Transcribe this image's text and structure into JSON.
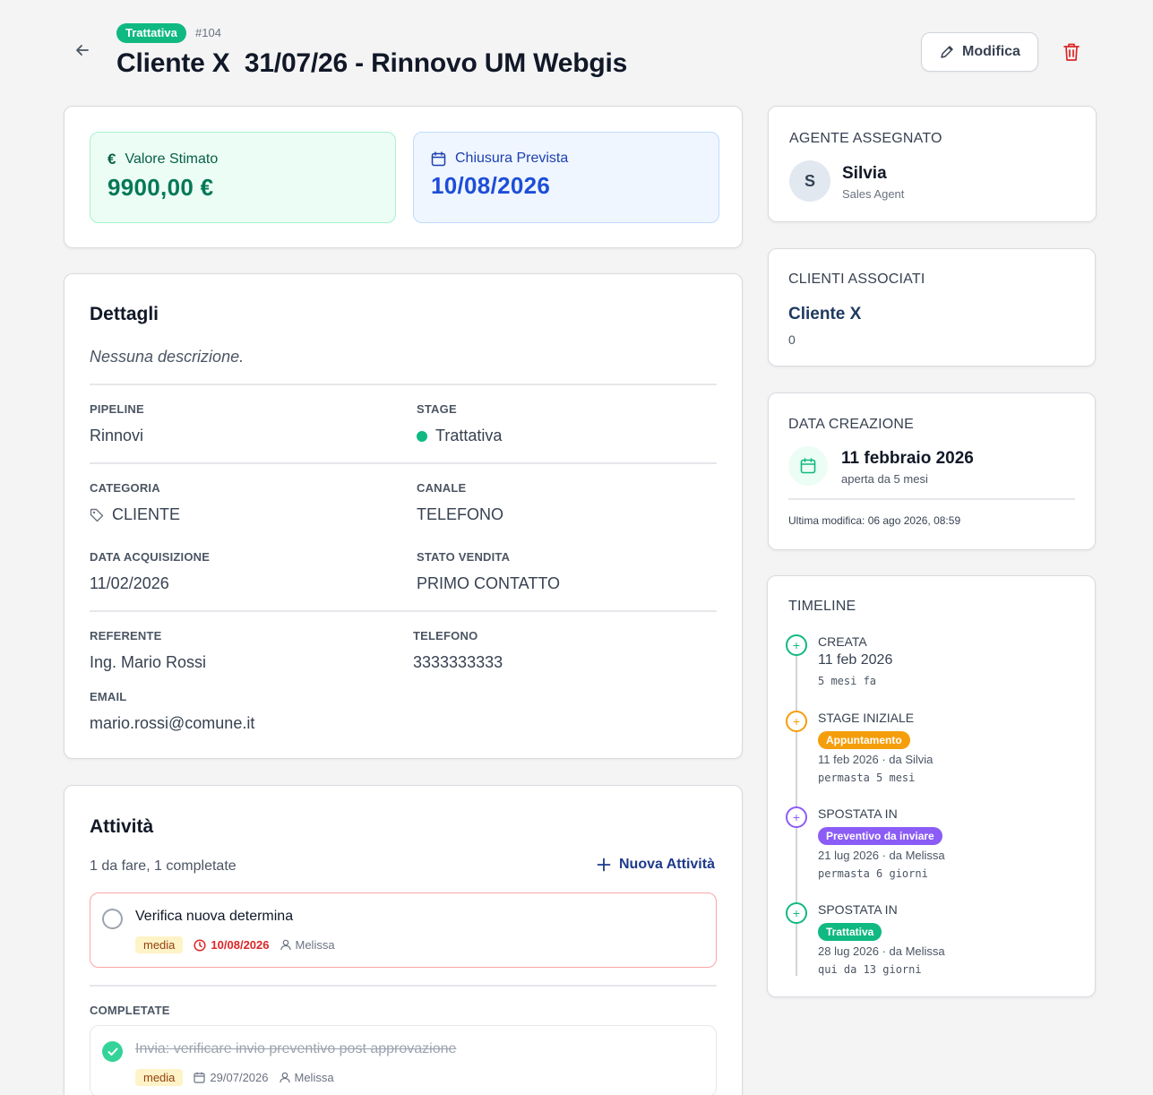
{
  "header": {
    "stage_badge": "Trattativa",
    "deal_id": "#104",
    "title": "Cliente X  31/07/26 - Rinnovo UM Webgis",
    "edit_label": "Modifica"
  },
  "summary": {
    "value_label": "Valore Stimato",
    "value": "9900,00 €",
    "close_label": "Chiusura Prevista",
    "close_date": "10/08/2026"
  },
  "details": {
    "title": "Dettagli",
    "description": "Nessuna descrizione.",
    "pipeline_label": "PIPELINE",
    "pipeline": "Rinnovi",
    "stage_label": "STAGE",
    "stage": "Trattativa",
    "category_label": "CATEGORIA",
    "category": "CLIENTE",
    "channel_label": "CANALE",
    "channel": "TELEFONO",
    "acquisition_label": "DATA ACQUISIZIONE",
    "acquisition": "11/02/2026",
    "sale_status_label": "STATO VENDITA",
    "sale_status": "PRIMO CONTATTO",
    "contact_label": "REFERENTE",
    "contact": "Ing. Mario Rossi",
    "phone_label": "TELEFONO",
    "phone": "3333333333",
    "email_label": "EMAIL",
    "email": "mario.rossi@comune.it"
  },
  "activities": {
    "title": "Attività",
    "summary": "1 da fare, 1 completate",
    "new_label": "Nuova Attività",
    "open": [
      {
        "title": "Verifica nuova determina",
        "priority": "media",
        "due": "10/08/2026",
        "assignee": "Melissa"
      }
    ],
    "completed_label": "COMPLETATE",
    "completed": [
      {
        "title": "Invia: verificare invio preventivo post approvazione",
        "priority": "media",
        "due": "29/07/2026",
        "assignee": "Melissa"
      }
    ]
  },
  "agent": {
    "label": "AGENTE ASSEGNATO",
    "initial": "S",
    "name": "Silvia",
    "role": "Sales Agent"
  },
  "clients": {
    "label": "CLIENTI ASSOCIATI",
    "name": "Cliente X",
    "count": "0"
  },
  "creation": {
    "label": "DATA CREAZIONE",
    "date": "11 febbraio 2026",
    "age": "aperta da 5 mesi",
    "last_modified": "Ultima modifica: 06 ago 2026, 08:59"
  },
  "timeline": {
    "label": "TIMELINE",
    "events": [
      {
        "head": "CREATA",
        "date": "11 feb 2026",
        "ago": "5 mesi fa"
      },
      {
        "head": "STAGE INIZIALE",
        "badge": "Appuntamento",
        "meta": "11 feb 2026 · da Silvia",
        "duration": "permasta 5 mesi"
      },
      {
        "head": "SPOSTATA IN",
        "badge": "Preventivo da inviare",
        "meta": "21 lug 2026 · da Melissa",
        "duration": "permasta 6 giorni"
      },
      {
        "head": "SPOSTATA IN",
        "badge": "Trattativa",
        "meta": "28 lug 2026 · da Melissa",
        "duration": "qui da 13 giorni"
      }
    ]
  },
  "colors": {
    "green": "#10b981",
    "orange": "#f59e0b",
    "purple": "#8b5cf6",
    "blue": "#1d4ed8",
    "red": "#dc2626"
  }
}
